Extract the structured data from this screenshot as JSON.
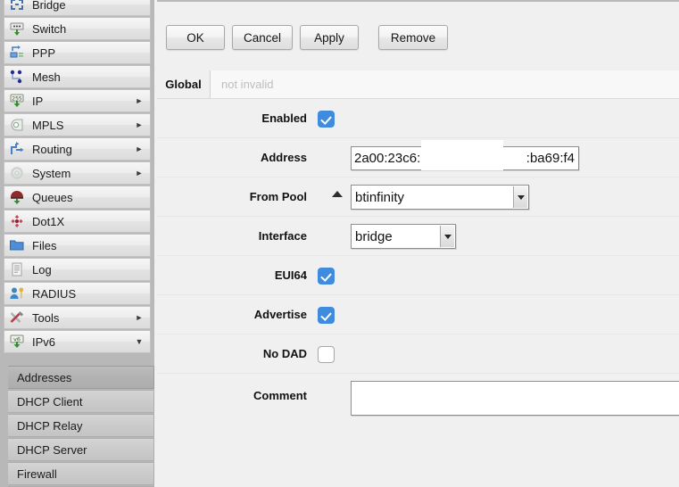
{
  "app": {
    "name": "WinBox RouterOS",
    "accent_color": "#3f8bdd",
    "sidebar_bg": "#b8b8b8",
    "panel_bg": "#f0f0f0"
  },
  "sidebar": {
    "items": [
      {
        "label": "Bridge",
        "icon": "bridge-icon",
        "arrow": ""
      },
      {
        "label": "Switch",
        "icon": "switch-icon",
        "arrow": ""
      },
      {
        "label": "PPP",
        "icon": "ppp-icon",
        "arrow": ""
      },
      {
        "label": "Mesh",
        "icon": "mesh-icon",
        "arrow": ""
      },
      {
        "label": "IP",
        "icon": "ip-icon",
        "arrow": "►"
      },
      {
        "label": "MPLS",
        "icon": "mpls-icon",
        "arrow": "►"
      },
      {
        "label": "Routing",
        "icon": "routing-icon",
        "arrow": "►"
      },
      {
        "label": "System",
        "icon": "system-icon",
        "arrow": "►"
      },
      {
        "label": "Queues",
        "icon": "queues-icon",
        "arrow": ""
      },
      {
        "label": "Dot1X",
        "icon": "dot1x-icon",
        "arrow": ""
      },
      {
        "label": "Files",
        "icon": "files-icon",
        "arrow": ""
      },
      {
        "label": "Log",
        "icon": "log-icon",
        "arrow": ""
      },
      {
        "label": "RADIUS",
        "icon": "radius-icon",
        "arrow": ""
      },
      {
        "label": "Tools",
        "icon": "tools-icon",
        "arrow": "►"
      },
      {
        "label": "IPv6",
        "icon": "ipv6-icon",
        "arrow": "▼"
      }
    ],
    "submenu": {
      "parent": "IPv6",
      "selected": "Addresses",
      "items": [
        {
          "label": "Addresses"
        },
        {
          "label": "DHCP Client"
        },
        {
          "label": "DHCP Relay"
        },
        {
          "label": "DHCP Server"
        },
        {
          "label": "Firewall"
        }
      ]
    }
  },
  "dialog": {
    "buttons": [
      {
        "label": "OK"
      },
      {
        "label": "Cancel"
      },
      {
        "label": "Apply"
      },
      {
        "label": "Remove"
      }
    ],
    "tabs": {
      "active": "Global",
      "status": "not invalid"
    },
    "fields": {
      "enabled": {
        "label": "Enabled",
        "type": "checkbox",
        "checked": true
      },
      "address": {
        "label": "Address",
        "type": "text",
        "value_left": "2a00:23c6:",
        "value_right": ":ba69:f4",
        "redacted": true
      },
      "from_pool": {
        "label": "From Pool",
        "type": "combo",
        "value": "btinfinity",
        "expander": "▲"
      },
      "interface": {
        "label": "Interface",
        "type": "combo",
        "value": "bridge"
      },
      "eui64": {
        "label": "EUI64",
        "type": "checkbox",
        "checked": true
      },
      "advertise": {
        "label": "Advertise",
        "type": "checkbox",
        "checked": true
      },
      "no_dad": {
        "label": "No DAD",
        "type": "checkbox",
        "checked": false
      },
      "comment": {
        "label": "Comment",
        "type": "textarea",
        "value": ""
      }
    }
  }
}
